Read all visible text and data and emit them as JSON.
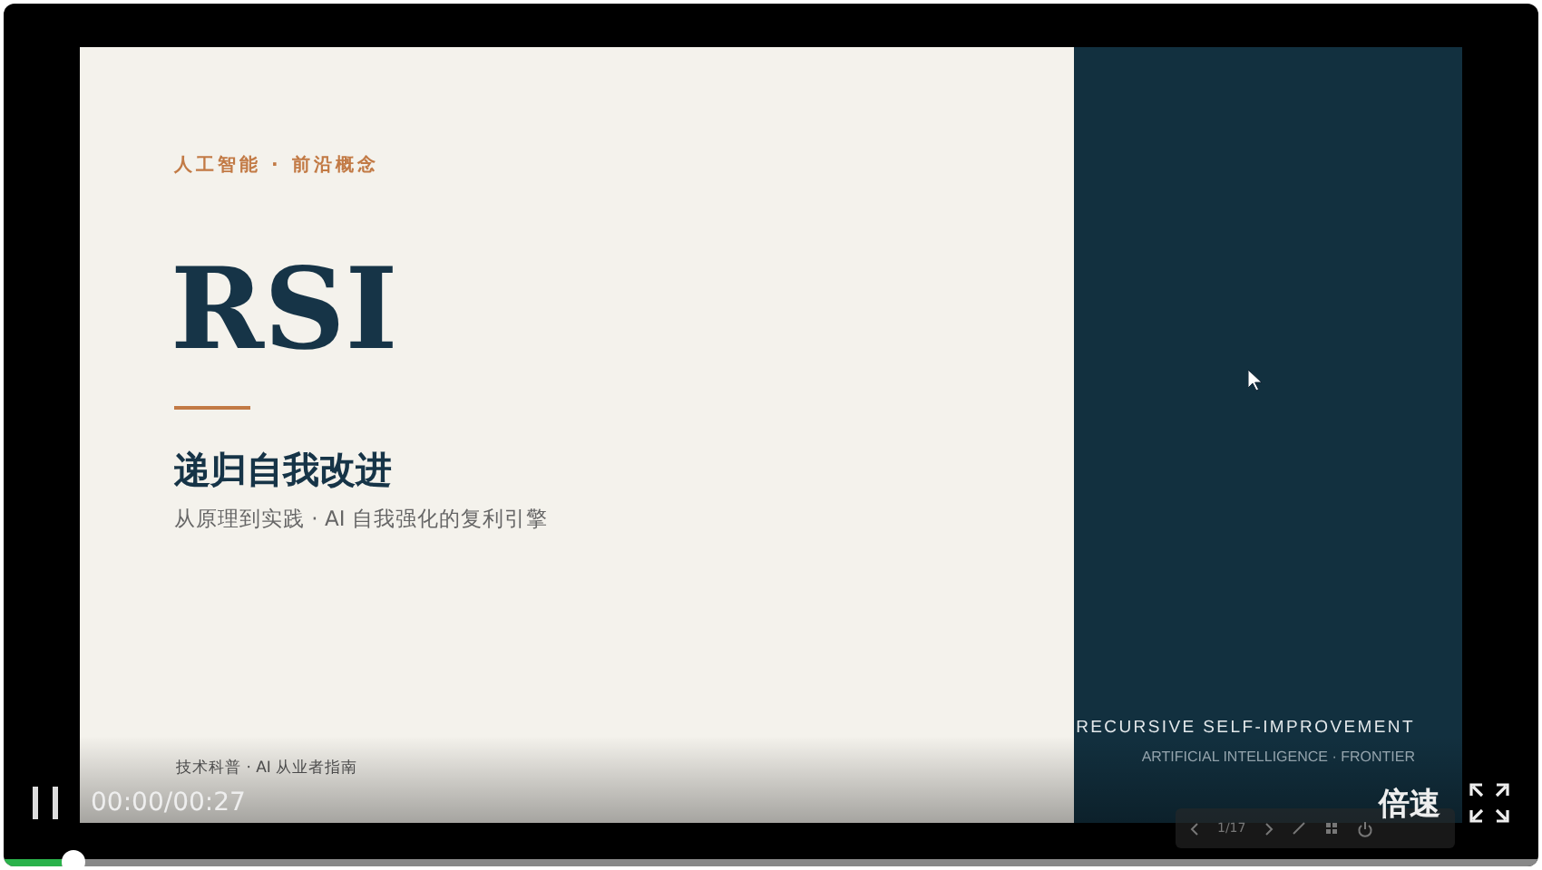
{
  "slide": {
    "kicker": "人工智能 · 前沿概念",
    "title": "RSI",
    "subtitle": "递归自我改进",
    "tagline": "从原理到实践 · AI 自我强化的复利引擎",
    "footer": "技术科普 · AI 从业者指南",
    "english_title": "RECURSIVE SELF-IMPROVEMENT",
    "english_subtitle": "ARTIFICIAL INTELLIGENCE · FRONTIER",
    "page_indicator": "1/17"
  },
  "player": {
    "playing": true,
    "time": "00:00/00:27",
    "speed_label": "倍速",
    "progress": {
      "level": 0.045
    }
  }
}
